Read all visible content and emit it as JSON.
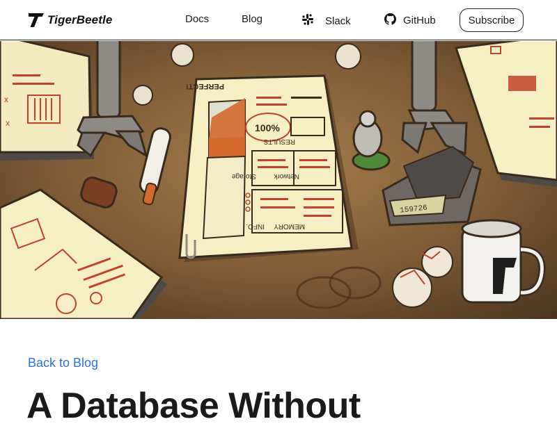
{
  "brand": {
    "name": "TigerBeetle",
    "icon": "tigerbeetle-logo-icon"
  },
  "nav": {
    "docs": "Docs",
    "blog": "Blog",
    "slack": {
      "label": "Slack",
      "icon": "slack-icon"
    },
    "github": {
      "label": "GitHub",
      "icon": "github-icon"
    },
    "subscribe": "Subscribe"
  },
  "hero": {
    "paper_text": {
      "perfect": "PERFECT!",
      "percent": "100%",
      "results": "RESULTS",
      "network": "Network",
      "storage": "Storage",
      "memory": "MEMORY",
      "info": "INFO.",
      "calculator_display": "159726"
    }
  },
  "article": {
    "back_link": "Back to Blog",
    "title": "A Database Without"
  },
  "colors": {
    "link_blue": "#2f6fdf",
    "text_dark": "#1a1a1a",
    "desk_brown": "#6a4b2c",
    "paper_cream": "#f6efc4",
    "ink_red": "#c0422a"
  }
}
